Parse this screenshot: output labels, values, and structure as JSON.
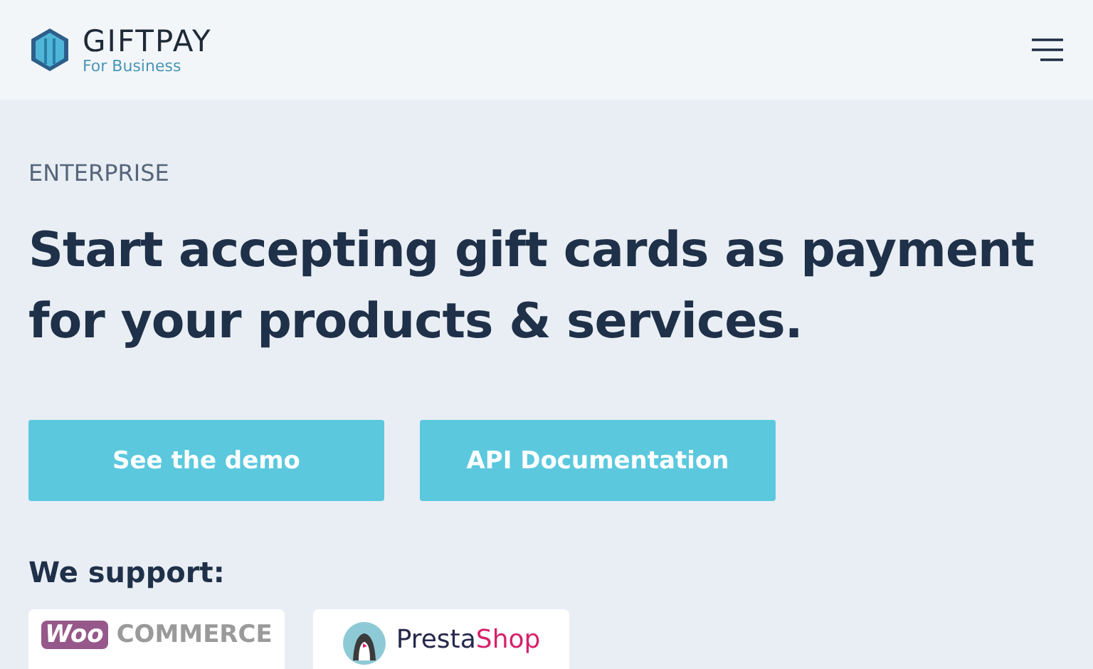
{
  "header": {
    "brand": "GIFTPAY",
    "tagline": "For Business"
  },
  "hero": {
    "eyebrow": "ENTERPRISE",
    "title": "Start accepting gift cards as payment for your products & services.",
    "buttons": [
      "See the demo",
      "API Documentation"
    ]
  },
  "support": {
    "heading": "We support:",
    "partners": [
      {
        "kind": "woocommerce",
        "badge": "Woo",
        "text": "COMMERCE"
      },
      {
        "kind": "prestashop",
        "text": "Presta",
        "accent": "Shop"
      }
    ]
  }
}
